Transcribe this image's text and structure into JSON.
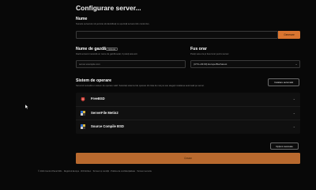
{
  "page": {
    "title": "Configurare server..."
  },
  "name_field": {
    "label": "Nume",
    "hint": "Numele serverului vă permite să identificați cu ușurință serverul din contul dvs.",
    "value": "",
    "generate_button": "Generare"
  },
  "hostname_field": {
    "label": "Nume de gazdă",
    "badge": "Opțional",
    "hint": "Dacă serverul necesită un nume de gazdă setat, îl puteți seta aici.",
    "placeholder": "server.example.com"
  },
  "timezone_field": {
    "label": "Fus orar",
    "hint": "Puteți seta ora și fusul orar pentru server.",
    "value": "(UTC+03:00) Europe/Bucharest"
  },
  "os_section": {
    "label": "Sistem de operare",
    "hint": "Serverul necesită un sistem de operare valid. Selectați sistemul de operare din lista de mai jos sau alegeți instalarea automată pe server.",
    "auto_install_button": "Instalare automată",
    "items": [
      {
        "label": "FreeBSD",
        "icon": "freebsd-icon"
      },
      {
        "label": "ServerFile Metin2",
        "icon": "serverfile-icon"
      },
      {
        "label": "Source Compile BSD",
        "icon": "source-compile-icon"
      }
    ],
    "more_options_button": "Opțiuni avansate"
  },
  "create_button": "Creare",
  "footer": "© 2024 Centrul Panel SRL · Registrul Europe · ROInfoSec · Termeni și condiții · Politica de confidențialitate · Termeni serviciu",
  "colors": {
    "accent": "#d97530",
    "background": "#080808"
  }
}
